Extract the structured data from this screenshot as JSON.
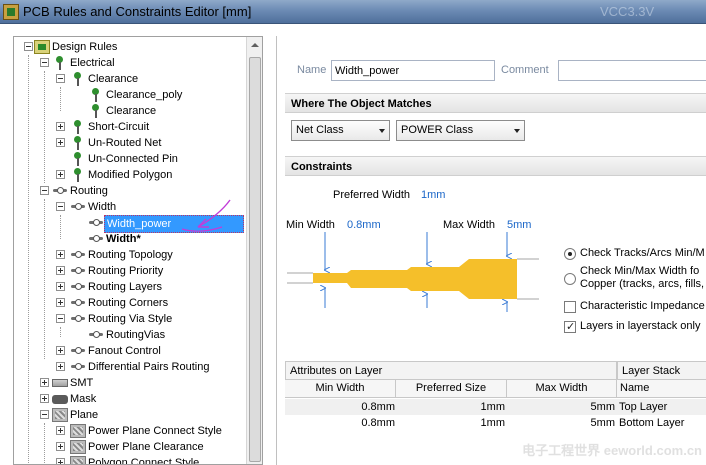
{
  "window": {
    "title": "PCB Rules and Constraints Editor [mm]",
    "bg_text": "VCC3.3V"
  },
  "tree": {
    "items": [
      {
        "label": "Design Rules"
      },
      {
        "label": "Electrical"
      },
      {
        "label": "Clearance"
      },
      {
        "label": "Clearance_poly"
      },
      {
        "label": "Clearance"
      },
      {
        "label": "Short-Circuit"
      },
      {
        "label": "Un-Routed Net"
      },
      {
        "label": "Un-Connected Pin"
      },
      {
        "label": "Modified Polygon"
      },
      {
        "label": "Routing"
      },
      {
        "label": "Width"
      },
      {
        "label": "Width_power"
      },
      {
        "label": "Width*"
      },
      {
        "label": "Routing Topology"
      },
      {
        "label": "Routing Priority"
      },
      {
        "label": "Routing Layers"
      },
      {
        "label": "Routing Corners"
      },
      {
        "label": "Routing Via Style"
      },
      {
        "label": "RoutingVias"
      },
      {
        "label": "Fanout Control"
      },
      {
        "label": "Differential Pairs Routing"
      },
      {
        "label": "SMT"
      },
      {
        "label": "Mask"
      },
      {
        "label": "Plane"
      },
      {
        "label": "Power Plane Connect Style"
      },
      {
        "label": "Power Plane Clearance"
      },
      {
        "label": "Polygon Connect Style"
      }
    ]
  },
  "rule": {
    "name_label": "Name",
    "name_value": "Width_power",
    "comment_label": "Comment",
    "comment_value": ""
  },
  "where": {
    "header": "Where The Object Matches",
    "scope_value": "Net Class",
    "class_value": "POWER Class"
  },
  "constraints": {
    "header": "Constraints",
    "preferred_label": "Preferred Width",
    "preferred_value": "1mm",
    "min_label": "Min Width",
    "min_value": "0.8mm",
    "max_label": "Max Width",
    "max_value": "5mm",
    "radio1_text": "Check Tracks/Arcs Min/M",
    "radio2_line1": "Check Min/Max Width fo",
    "radio2_line2": "Copper (tracks, arcs, fills,",
    "check1_text": "Characteristic Impedance",
    "check2_text": "Layers in layerstack only",
    "radio1_selected": true,
    "radio2_selected": false,
    "check1_checked": false,
    "check2_checked": true,
    "trace_color": "#f5bf2a"
  },
  "table": {
    "group_attrs": "Attributes on Layer",
    "group_stack": "Layer Stack Refer",
    "columns": [
      "Min Width",
      "Preferred Size",
      "Max Width",
      "Name"
    ],
    "rows": [
      {
        "min": "0.8mm",
        "pref": "1mm",
        "max": "5mm",
        "name": "Top Layer"
      },
      {
        "min": "0.8mm",
        "pref": "1mm",
        "max": "5mm",
        "name": "Bottom Layer"
      }
    ]
  },
  "watermark": "电子工程世界 eeworld.com.cn"
}
